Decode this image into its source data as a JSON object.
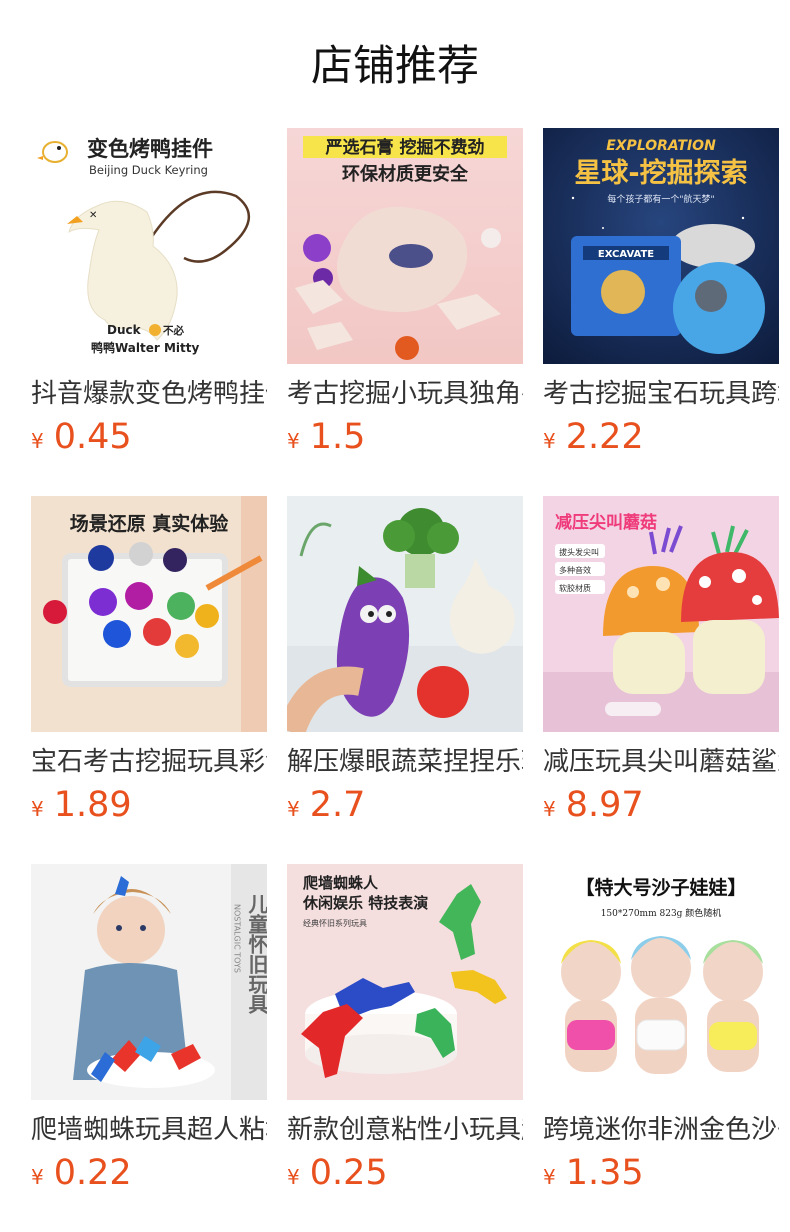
{
  "page": {
    "title": "店铺推荐",
    "currency": "¥"
  },
  "products": [
    {
      "title": "抖音爆款变色烤鸭挂件",
      "price": "0.45",
      "image": {
        "headline": "变色烤鸭挂件",
        "sub": "Beijing Duck Keyring",
        "brand_line1": "Duck",
        "brand_line1b": "不必",
        "brand_line2": "鸭鸭Walter Mitty"
      }
    },
    {
      "title": "考古挖掘小玩具独角兽",
      "price": "1.5",
      "image": {
        "line1": "严选石膏 挖掘不费劲",
        "line2": "环保材质更安全"
      }
    },
    {
      "title": "考古挖掘宝石玩具跨境",
      "price": "2.22",
      "image": {
        "top": "EXPLORATION",
        "headline": "星球-挖掘探索",
        "sub": "每个孩子都有一个\"航天梦\"",
        "box": "EXCAVATE"
      }
    },
    {
      "title": "宝石考古挖掘玩具彩色",
      "price": "1.89",
      "image": {
        "headline": "场景还原 真实体验"
      }
    },
    {
      "title": "解压爆眼蔬菜捏捏乐玩具",
      "price": "2.7",
      "image": {}
    },
    {
      "title": "减压玩具尖叫蘑菇鲨鱼",
      "price": "8.97",
      "image": {
        "headline": "减压尖叫蘑菇",
        "tags": [
          "拔头发尖叫",
          "多种音效",
          "软胶材质"
        ]
      }
    },
    {
      "title": "爬墙蜘蛛玩具超人粘墙",
      "price": "0.22",
      "image": {
        "vertical": "儿童怀旧玩具",
        "vertical_en": "NOSTALGIC TOYS"
      }
    },
    {
      "title": "新款创意粘性小玩具超人",
      "price": "0.25",
      "image": {
        "line1": "爬墙蜘蛛人",
        "line2": "休闲娱乐 特技表演",
        "line3": "经典怀旧系列玩具"
      }
    },
    {
      "title": "跨境迷你非洲金色沙子娃娃",
      "price": "1.35",
      "image": {
        "headline": "【特大号沙子娃娃】",
        "sub": "150*270mm  823g  颜色随机"
      }
    }
  ],
  "colors": {
    "price": "#e8501e",
    "title": "#111111",
    "text": "#333333"
  }
}
